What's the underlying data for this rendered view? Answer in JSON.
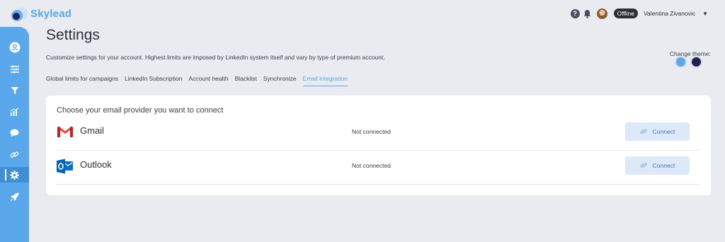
{
  "app": {
    "name": "Skylead"
  },
  "header": {
    "help_icon": "?",
    "status": "Offline",
    "user_name": "Valentina Zivanovic"
  },
  "sidebar": {
    "items": [
      {
        "icon": "user-icon"
      },
      {
        "icon": "sliders-icon"
      },
      {
        "icon": "funnel-icon"
      },
      {
        "icon": "chart-icon"
      },
      {
        "icon": "chat-icon"
      },
      {
        "icon": "link-icon"
      },
      {
        "icon": "gear-icon",
        "active": true
      },
      {
        "icon": "rocket-icon"
      }
    ]
  },
  "page": {
    "title": "Settings",
    "description": "Customize settings for your account. Highest limits are imposed by LinkedIn system itself and vary by type of premium account.",
    "theme_label": "Change theme:"
  },
  "tabs": [
    {
      "label": "Global limits for campaigns"
    },
    {
      "label": "LinkedIn Subscription"
    },
    {
      "label": "Account health"
    },
    {
      "label": "Blacklist"
    },
    {
      "label": "Synchronize"
    },
    {
      "label": "Email integration",
      "active": true
    }
  ],
  "email_integration": {
    "title": "Choose your email provider you want to connect",
    "providers": [
      {
        "name": "Gmail",
        "status": "Not connected",
        "button": "Connect",
        "icon": "gmail-icon"
      },
      {
        "name": "Outlook",
        "status": "Not connected",
        "button": "Connect",
        "icon": "outlook-icon"
      }
    ]
  },
  "colors": {
    "accent": "#5aa7ec",
    "background": "#e9ebf1",
    "card": "#ffffff",
    "theme_light": "#5aa7ec",
    "theme_dark": "#1e2452"
  }
}
